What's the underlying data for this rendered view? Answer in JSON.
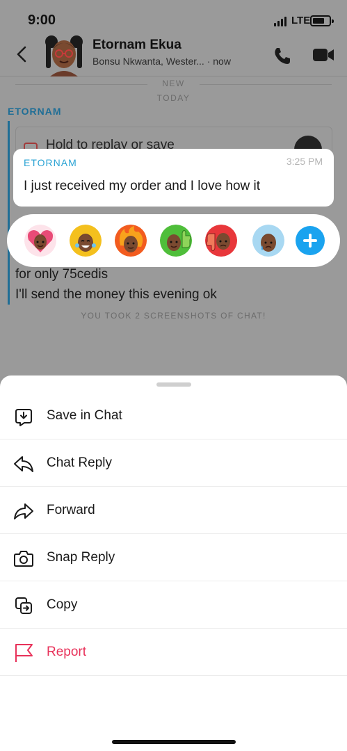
{
  "status_bar": {
    "time": "9:00",
    "network": "LTE"
  },
  "chat_header": {
    "contact_name": "Etornam Ekua",
    "subtitle": "Bonsu Nkwanta, Wester... · now"
  },
  "chat": {
    "new_separator": "NEW",
    "today_label": "TODAY",
    "sender": "ETORNAM",
    "hold_hint": "Hold to replay or save",
    "lines": [
      "for only 75cedis",
      "I'll send the money this evening ok"
    ],
    "screenshot_note": "YOU TOOK 2 SCREENSHOTS OF CHAT!"
  },
  "focused_message": {
    "sender": "ETORNAM",
    "time": "3:25 PM",
    "text": "I just received my order and I love how it"
  },
  "reactions": [
    {
      "name": "love-reaction",
      "accent": "#e94b77"
    },
    {
      "name": "laugh-reaction",
      "accent": "#f4c01e"
    },
    {
      "name": "fire-reaction",
      "accent": "#f25c1f"
    },
    {
      "name": "thumbs-up-reaction",
      "accent": "#4fbe3a"
    },
    {
      "name": "thumbs-down-reaction",
      "accent": "#e8373b"
    },
    {
      "name": "sad-reaction",
      "accent": "#3b9bd8"
    }
  ],
  "actions": [
    {
      "label": "Save in Chat",
      "icon": "save-in-chat-icon"
    },
    {
      "label": "Chat Reply",
      "icon": "reply-icon"
    },
    {
      "label": "Forward",
      "icon": "forward-icon"
    },
    {
      "label": "Snap Reply",
      "icon": "camera-icon"
    },
    {
      "label": "Copy",
      "icon": "copy-icon"
    },
    {
      "label": "Report",
      "icon": "flag-icon"
    }
  ],
  "colors": {
    "accent_blue": "#1aa3ef",
    "danger": "#e8325a",
    "sender_blue": "#2aa3d4"
  }
}
